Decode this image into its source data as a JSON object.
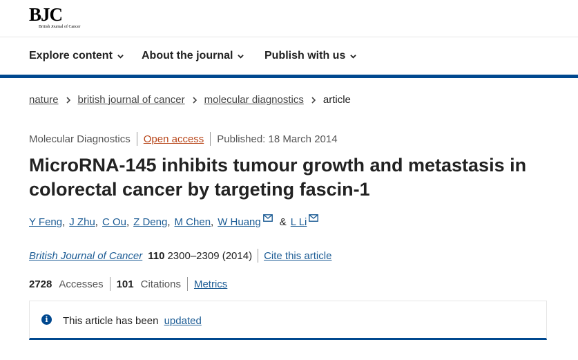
{
  "brand": {
    "logo_text": "BJC",
    "logo_subtitle": "British Journal of Cancer"
  },
  "nav": {
    "items": [
      {
        "label": "Explore content"
      },
      {
        "label": "About the journal"
      },
      {
        "label": "Publish with us"
      }
    ]
  },
  "breadcrumb": {
    "items": [
      "nature",
      "british journal of cancer",
      "molecular diagnostics"
    ],
    "current": "article"
  },
  "article": {
    "section": "Molecular Diagnostics",
    "access": "Open access",
    "published": "Published: 18 March 2014",
    "title": "MicroRNA-145 inhibits tumour growth and metastasis in colorectal cancer by targeting fascin-1",
    "authors": [
      "Y Feng",
      "J Zhu",
      "C Ou",
      "Z Deng",
      "M Chen",
      "W Huang",
      "L Li"
    ],
    "author_conjunction": "&",
    "journal": "British Journal of Cancer",
    "volume": "110",
    "pages_year": "2300–2309 (2014)",
    "cite_label": "Cite this article"
  },
  "metrics": {
    "accesses_count": "2728",
    "accesses_label": "Accesses",
    "citations_count": "101",
    "citations_label": "Citations",
    "metrics_link": "Metrics"
  },
  "notice": {
    "icon_glyph": "i",
    "text": "This article has been",
    "link": "updated"
  }
}
